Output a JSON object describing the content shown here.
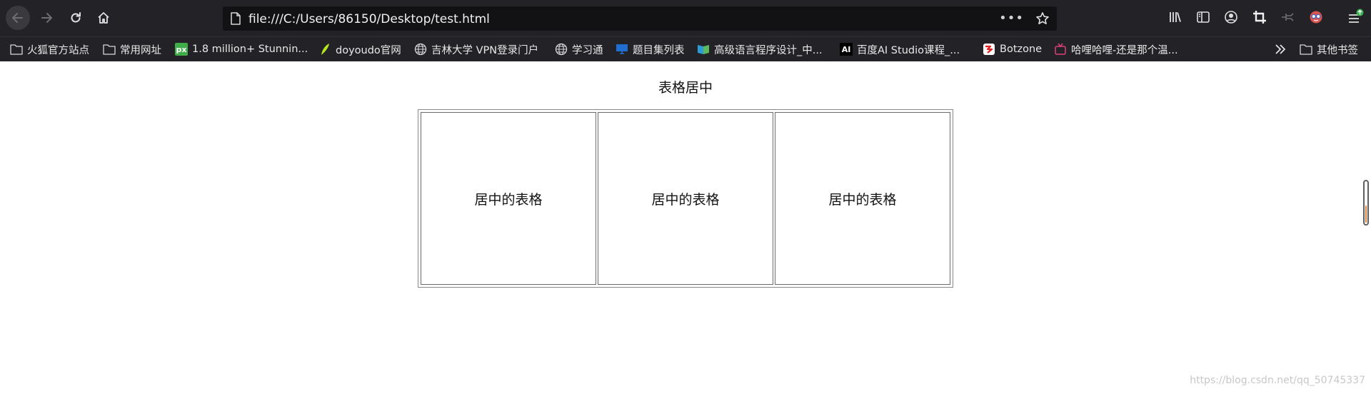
{
  "browser": {
    "url": "file:///C:/Users/86150/Desktop/test.html",
    "url_menu": "•••",
    "toolbar_icons": [
      "back-arrow-icon",
      "forward-arrow-icon",
      "reload-icon",
      "home-icon",
      "page-icon",
      "star-icon",
      "library-icon",
      "sidebar-icon",
      "account-icon",
      "crop-icon",
      "pin-icon",
      "extension-face-icon",
      "menu-icon"
    ],
    "accent_color": "#e6823a",
    "toolbar_bg": "#232327"
  },
  "bookmarks": [
    {
      "label": "火狐官方站点",
      "icon": "folder-icon"
    },
    {
      "label": "常用网址",
      "icon": "folder-icon"
    },
    {
      "label": "1.8 million+ Stunnin...",
      "icon": "px-logo-icon",
      "badge": "px"
    },
    {
      "label": "doyoudo官网",
      "icon": "feather-icon"
    },
    {
      "label": "吉林大学 VPN登录门户",
      "icon": "globe-icon"
    },
    {
      "label": "学习通",
      "icon": "globe-icon"
    },
    {
      "label": "题目集列表",
      "icon": "monitor-icon"
    },
    {
      "label": "高级语言程序设计_中...",
      "icon": "book-icon"
    },
    {
      "label": "百度AI Studio课程_...",
      "icon": "ai-logo-icon",
      "badge": "AI"
    },
    {
      "label": "Botzone",
      "icon": "botzone-icon"
    },
    {
      "label": "哈哩哈哩-还是那个温...",
      "icon": "tv-icon"
    }
  ],
  "bookmarks_overflow": {
    "icon": "chevron-double-right-icon"
  },
  "other_bookmarks": {
    "label": "其他书签",
    "icon": "folder-icon"
  },
  "page": {
    "caption": "表格居中",
    "cells": [
      "居中的表格",
      "居中的表格",
      "居中的表格"
    ]
  },
  "watermark": "https://blog.csdn.net/qq_50745337"
}
